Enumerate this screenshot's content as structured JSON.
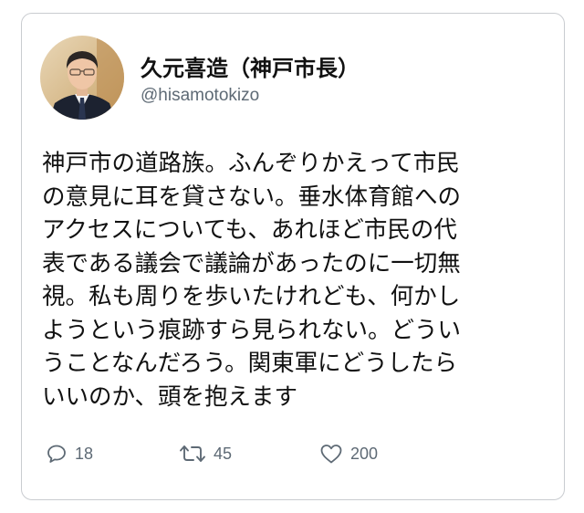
{
  "user": {
    "display_name": "久元喜造（神戸市長）",
    "handle": "@hisamotokizo"
  },
  "tweet": {
    "lines": [
      "神戸市の道路族。ふんぞりかえって市民",
      "の意見に耳を貸さない。垂水体育館への",
      "アクセスについても、あれほど市民の代",
      "表である議会で議論があったのに一切無",
      "視。私も周りを歩いたけれども、何かし",
      "ようという痕跡すら見られない。どうい",
      "うことなんだろう。関東軍にどうしたら",
      "いいのか、頭を抱えます"
    ]
  },
  "actions": {
    "reply_count": "18",
    "retweet_count": "45",
    "like_count": "200"
  },
  "icons": {
    "reply": "reply-icon",
    "retweet": "retweet-icon",
    "like": "heart-icon"
  },
  "colors": {
    "text": "#111111",
    "muted": "#5e6a75",
    "border": "#c9ccd0"
  }
}
